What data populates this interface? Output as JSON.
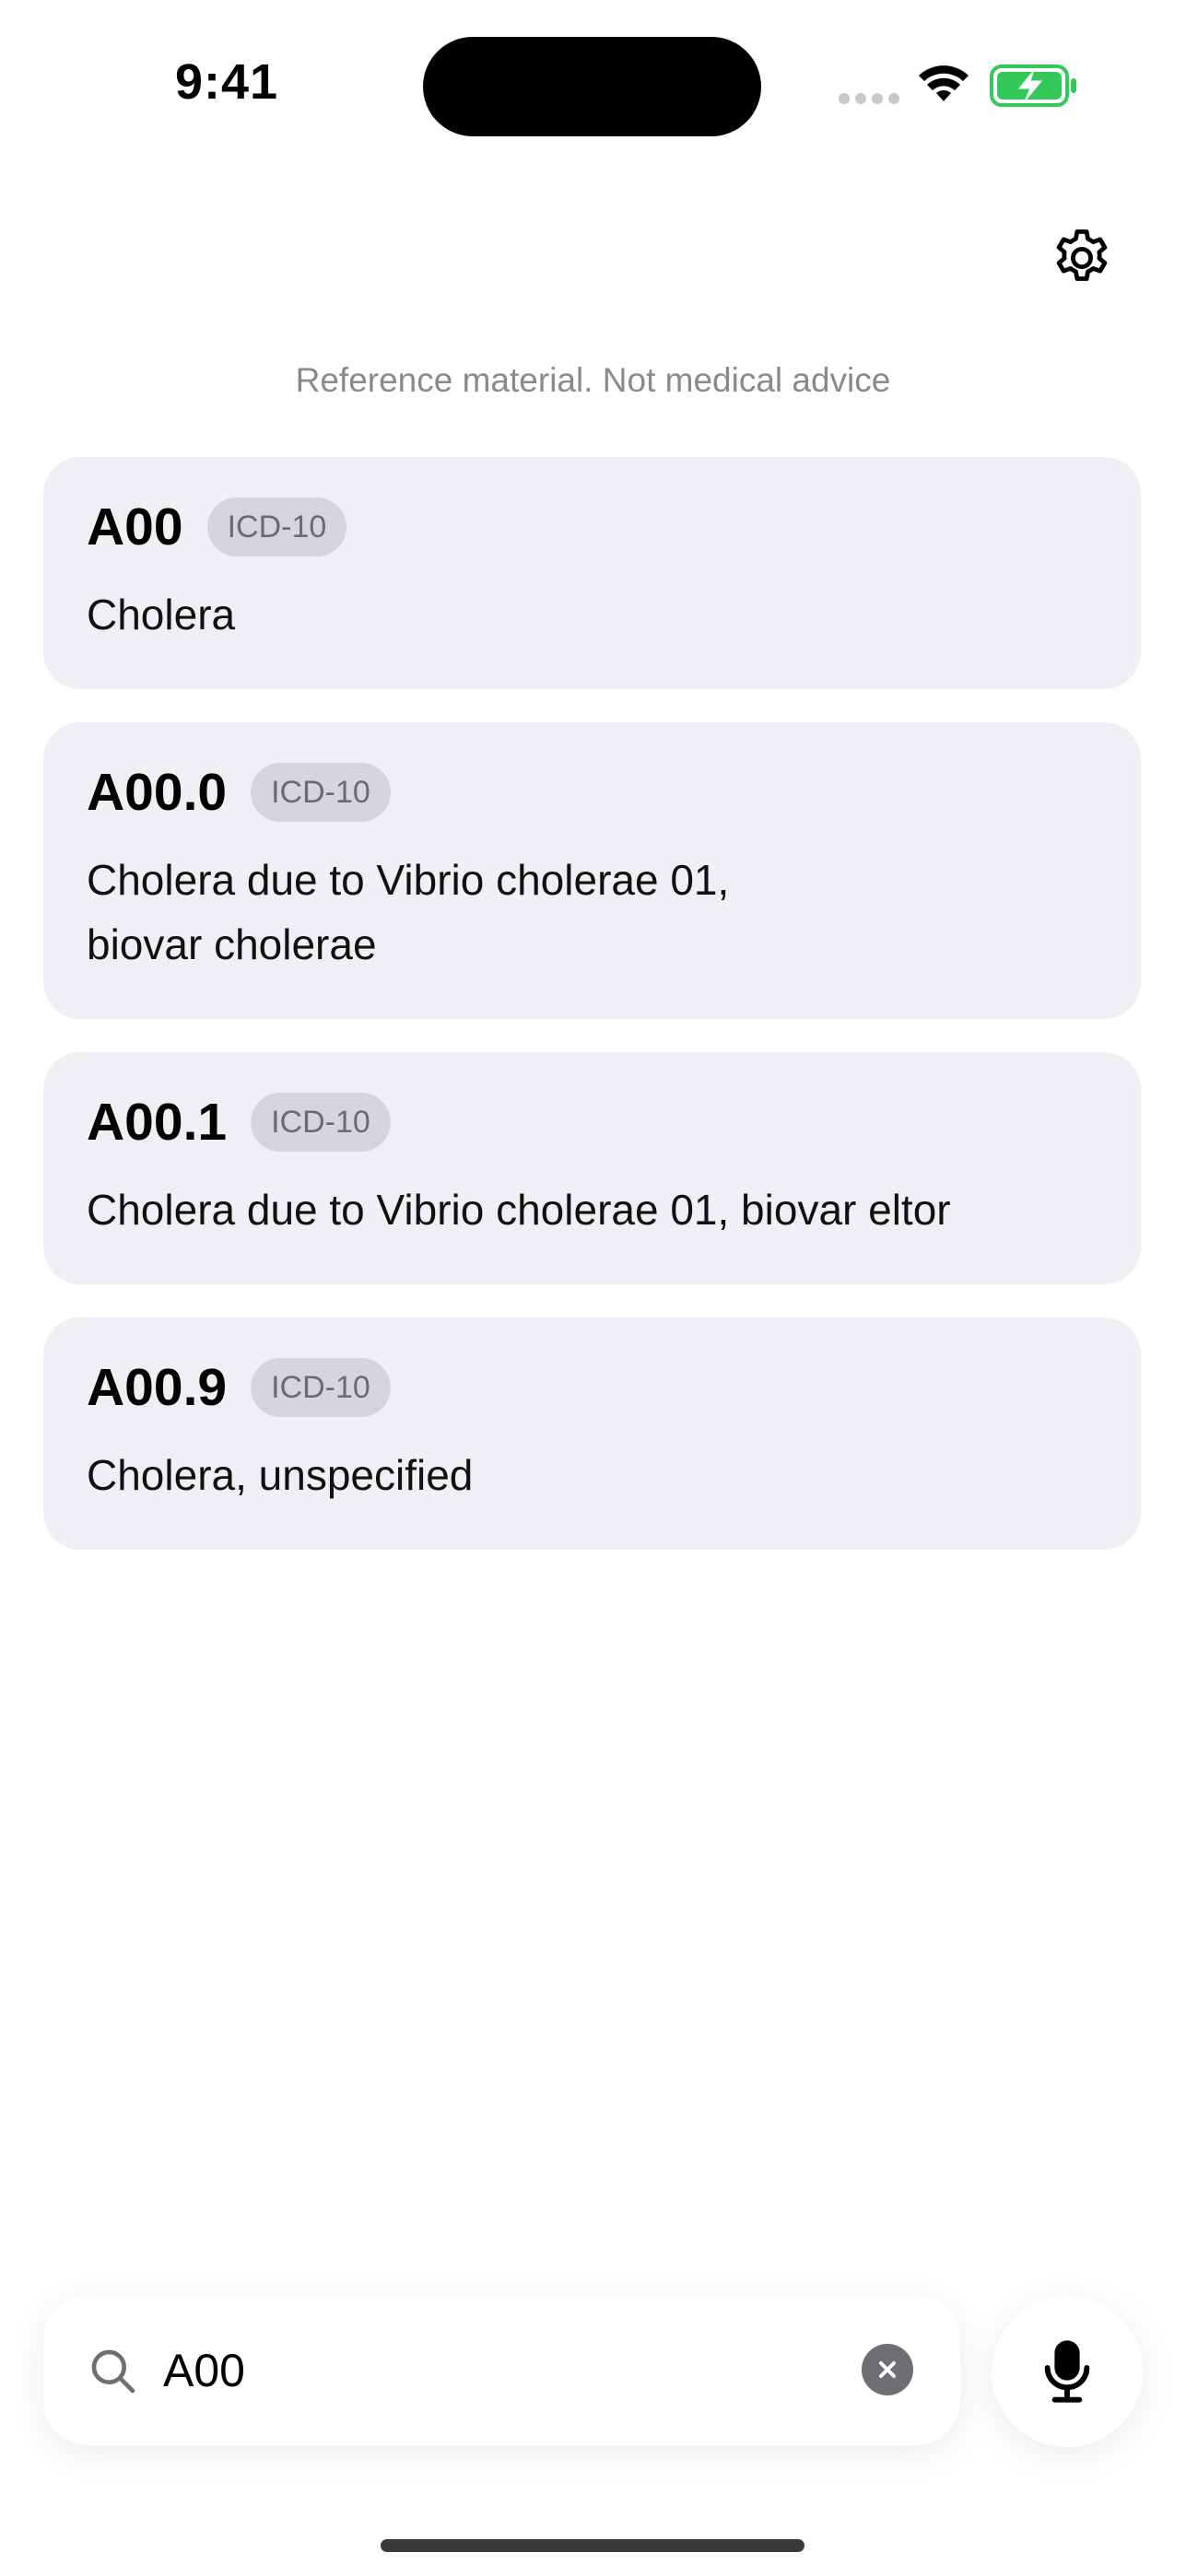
{
  "status_bar": {
    "time": "9:41"
  },
  "header": {
    "settings_icon": "gear-icon"
  },
  "disclaimer": "Reference material. Not medical advice",
  "results": [
    {
      "code": "A00",
      "badge": "ICD-10",
      "description": "Cholera"
    },
    {
      "code": "A00.0",
      "badge": "ICD-10",
      "description": "Cholera due to Vibrio cholerae 01,\nbiovar cholerae"
    },
    {
      "code": "A00.1",
      "badge": "ICD-10",
      "description": "Cholera due to Vibrio cholerae 01, biovar eltor"
    },
    {
      "code": "A00.9",
      "badge": "ICD-10",
      "description": "Cholera, unspecified"
    }
  ],
  "search": {
    "value": "A00",
    "placeholder": ""
  },
  "colors": {
    "card_bg": "#f0f0f4",
    "badge_bg": "#d6d6da",
    "battery": "#34c759"
  }
}
